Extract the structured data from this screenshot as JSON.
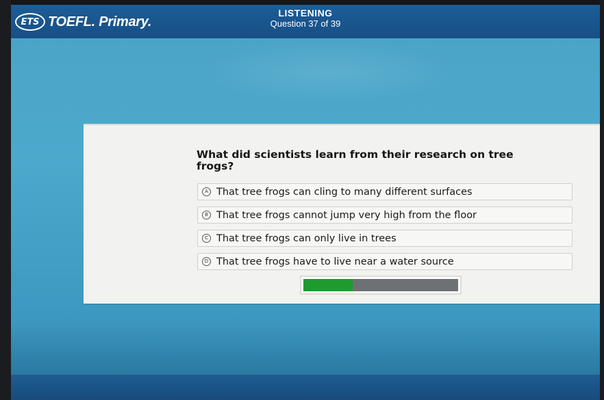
{
  "header": {
    "logo_mark": "ETS",
    "brand": "TOEFL. Primary.",
    "section_title": "LISTENING",
    "question_counter": "Question 37 of 39"
  },
  "question": {
    "prompt": "What did scientists learn from their research on tree frogs?",
    "options": [
      {
        "letter": "A",
        "text": "That tree frogs can cling to many different surfaces"
      },
      {
        "letter": "B",
        "text": "That tree frogs cannot jump very high from the floor"
      },
      {
        "letter": "C",
        "text": "That tree frogs can only live in trees"
      },
      {
        "letter": "D",
        "text": "That tree frogs have to live near a water source"
      }
    ]
  },
  "audio_progress": {
    "fraction": 0.32
  },
  "colors": {
    "header_bar": "#1c5d96",
    "background": "#4aa3c6",
    "progress_fill": "#1f9a2e",
    "progress_track": "#6e7174"
  }
}
